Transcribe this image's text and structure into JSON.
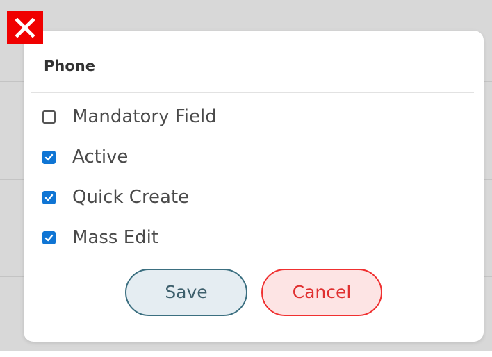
{
  "dialog": {
    "title": "Phone",
    "options": [
      {
        "label": "Mandatory Field",
        "checked": false
      },
      {
        "label": "Active",
        "checked": true
      },
      {
        "label": "Quick Create",
        "checked": true
      },
      {
        "label": "Mass Edit",
        "checked": true
      }
    ],
    "save_label": "Save",
    "cancel_label": "Cancel"
  },
  "icons": {
    "close": "close-icon",
    "check": "checkmark-icon"
  },
  "colors": {
    "close_button": "#f00000",
    "checkbox_checked": "#0f75d4",
    "save_border": "#3b6f80",
    "save_background": "#e5edf2",
    "cancel_border": "#f03030",
    "cancel_background": "#fde4e4"
  }
}
